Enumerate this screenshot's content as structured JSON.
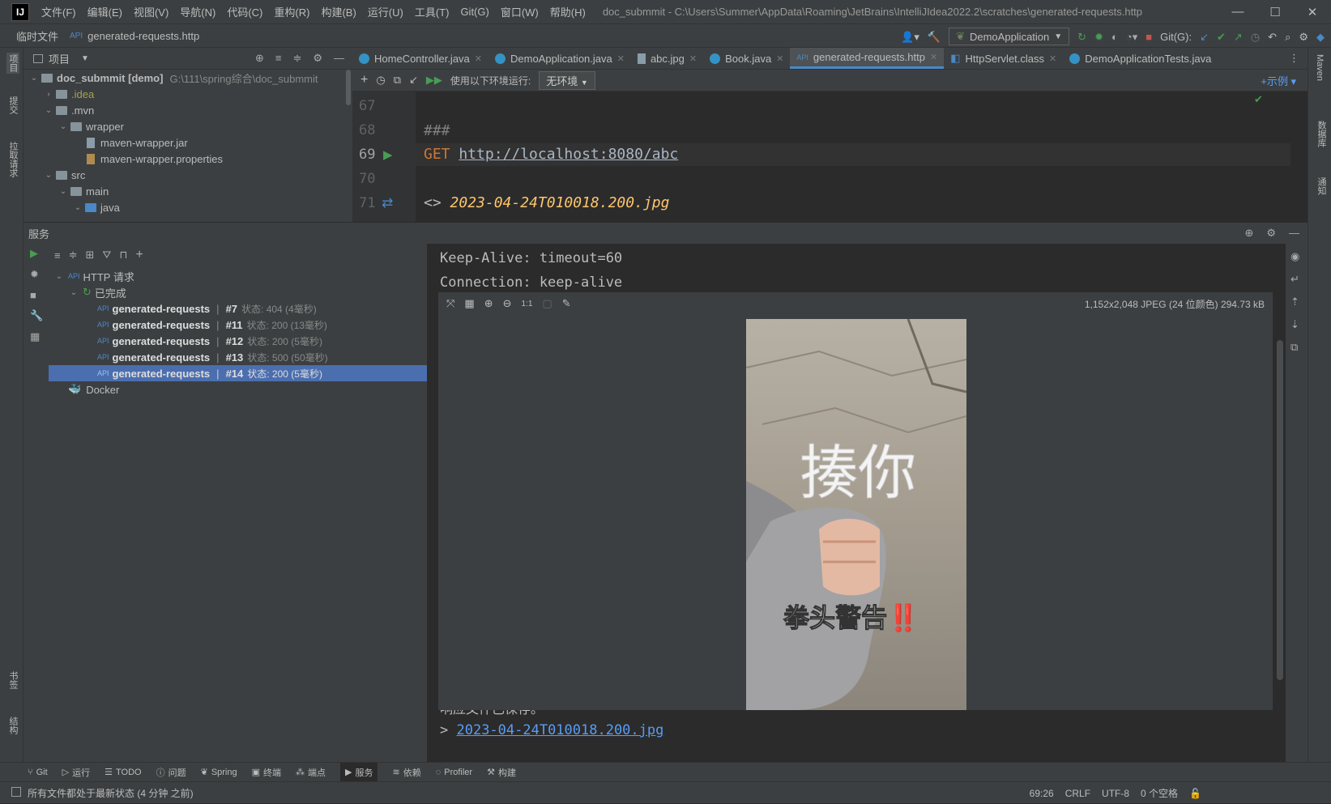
{
  "titlebar": {
    "menus": [
      "文件(F)",
      "编辑(E)",
      "视图(V)",
      "导航(N)",
      "代码(C)",
      "重构(R)",
      "构建(B)",
      "运行(U)",
      "工具(T)",
      "Git(G)",
      "窗口(W)",
      "帮助(H)"
    ],
    "title": "doc_submmit - C:\\Users\\Summer\\AppData\\Roaming\\JetBrains\\IntelliJIdea2022.2\\scratches\\generated-requests.http"
  },
  "navbar": {
    "crumb1": "临时文件",
    "crumb2": "generated-requests.http",
    "run_config": "DemoApplication",
    "git_label": "Git(G):"
  },
  "left_stripe": {
    "project": "项目",
    "commit": "提交",
    "pull_requests": "拉取请求",
    "bookmarks": "书签",
    "structure": "结构"
  },
  "right_stripe": {
    "maven": "Maven",
    "database": "数据库",
    "notifications": "通知"
  },
  "project_panel": {
    "title": "项目",
    "tree": [
      {
        "label": "doc_submmit [demo]",
        "extra": "G:\\111\\spring综合\\doc_submmit",
        "depth": 0,
        "kind": "folder"
      },
      {
        "label": ".idea",
        "depth": 1,
        "kind": "folder"
      },
      {
        "label": ".mvn",
        "depth": 1,
        "kind": "folder"
      },
      {
        "label": "wrapper",
        "depth": 2,
        "kind": "folder"
      },
      {
        "label": "maven-wrapper.jar",
        "depth": 3,
        "kind": "file"
      },
      {
        "label": "maven-wrapper.properties",
        "depth": 3,
        "kind": "file"
      },
      {
        "label": "src",
        "depth": 1,
        "kind": "folder"
      },
      {
        "label": "main",
        "depth": 2,
        "kind": "folder"
      },
      {
        "label": "java",
        "depth": 3,
        "kind": "folder"
      }
    ]
  },
  "editor": {
    "tabs": [
      {
        "label": "HomeController.java",
        "active": false
      },
      {
        "label": "DemoApplication.java",
        "active": false
      },
      {
        "label": "abc.jpg",
        "active": false
      },
      {
        "label": "Book.java",
        "active": false
      },
      {
        "label": "generated-requests.http",
        "active": true
      },
      {
        "label": "HttpServlet.class",
        "active": false
      },
      {
        "label": "DemoApplicationTests.java",
        "active": false
      }
    ],
    "toolbar": {
      "env_label": "使用以下环境运行:",
      "env_value": "无环境",
      "examples": "示例"
    },
    "lines": [
      {
        "num": "67",
        "text": ""
      },
      {
        "num": "68",
        "text": "###"
      },
      {
        "num": "69",
        "method": "GET",
        "url": "http://localhost:8080/abc"
      },
      {
        "num": "70",
        "text": ""
      },
      {
        "num": "71",
        "prefix": "<>",
        "file": "2023-04-24T010018.200.jpg"
      }
    ]
  },
  "services": {
    "title": "服务",
    "tree": {
      "root": "HTTP 请求",
      "group": "已完成",
      "items": [
        {
          "name": "generated-requests",
          "num": "#7",
          "status": "状态: 404 (4毫秒)",
          "selected": false
        },
        {
          "name": "generated-requests",
          "num": "#11",
          "status": "状态: 200 (13毫秒)",
          "selected": false
        },
        {
          "name": "generated-requests",
          "num": "#12",
          "status": "状态: 200 (5毫秒)",
          "selected": false
        },
        {
          "name": "generated-requests",
          "num": "#13",
          "status": "状态: 500 (50毫秒)",
          "selected": false
        },
        {
          "name": "generated-requests",
          "num": "#14",
          "status": "状态: 200 (5毫秒)",
          "selected": true
        }
      ],
      "docker": "Docker"
    },
    "response": {
      "header1": "Keep-Alive: timeout=60",
      "header2": "Connection: keep-alive",
      "image_info": "1,152x2,048 JPEG (24 位颜色) 294.73 kB",
      "image_text_big": "揍你",
      "image_text_small": "拳头警告‼️",
      "saved_msg": "响应文件已保存。",
      "saved_file": "2023-04-24T010018.200.jpg"
    }
  },
  "bottom_tools": [
    "Git",
    "运行",
    "TODO",
    "问题",
    "Spring",
    "终端",
    "端点",
    "服务",
    "依赖",
    "Profiler",
    "构建"
  ],
  "statusbar": {
    "message": "所有文件都处于最新状态 (4 分钟 之前)",
    "position": "69:26",
    "line_sep": "CRLF",
    "encoding": "UTF-8",
    "indent": "0 个空格"
  }
}
